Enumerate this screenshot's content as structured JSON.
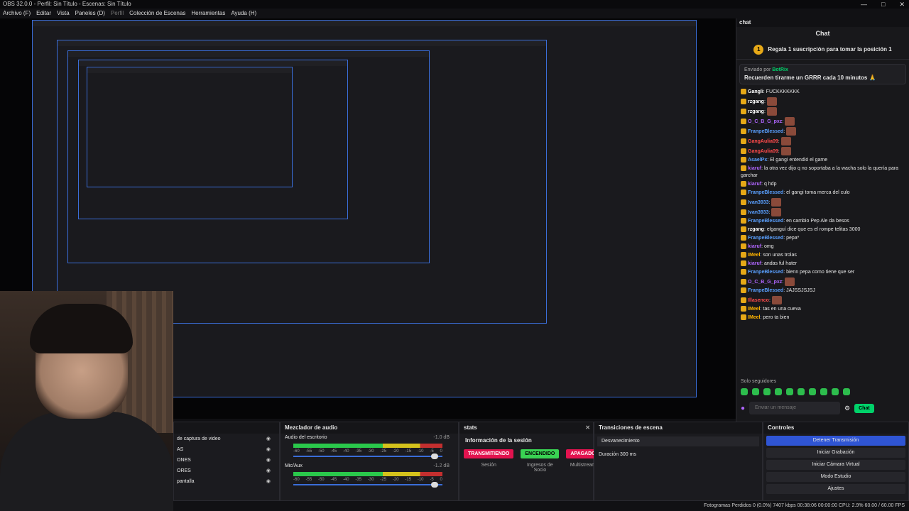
{
  "window": {
    "title": "OBS 32.0.0 - Perfil: Sin Título - Escenas: Sin Título",
    "min": "—",
    "max": "□",
    "close": "✕"
  },
  "menu": [
    "Archivo (F)",
    "Editar",
    "Vista",
    "Paneles (D)",
    "Perfil",
    "Colección de Escenas",
    "Herramientas",
    "Ayuda (H)"
  ],
  "chat": {
    "dock_title": "chat",
    "title": "Chat",
    "promo": "Regala 1 suscripción para tomar la posición 1",
    "promo_badge": "1",
    "pinned_by_prefix": "Enviado por",
    "pinned_user": "BotRix",
    "pinned_msg": "Recuerden tirarme un GRRR cada 10 minutos 🙏",
    "messages": [
      {
        "user": "Gangli",
        "text": "FUCKKKKKKK",
        "color": "#ffffff"
      },
      {
        "user": "rzgang",
        "text": "",
        "emote": true,
        "color": "#ffffff"
      },
      {
        "user": "rzgang",
        "text": "",
        "emote": true,
        "color": "#ffffff"
      },
      {
        "user": "O_C_B_G_pxz",
        "text": "",
        "emote": true,
        "color": "#b066ff"
      },
      {
        "user": "FranpeBlessed",
        "text": "",
        "emote": true,
        "color": "#5aa0ff"
      },
      {
        "user": "GangAulia09",
        "text": "",
        "emote": true,
        "color": "#ff4b4b"
      },
      {
        "user": "GangAulia09",
        "text": "",
        "emote": true,
        "color": "#ff4b4b"
      },
      {
        "user": "AsaelPx",
        "text": "El gangi entendió el game",
        "color": "#5aa0ff"
      },
      {
        "user": "kiaruf",
        "text": "la otra vez dijo q no soportaba a la wacha solo la quería para garchar",
        "color": "#b066ff"
      },
      {
        "user": "kiaruf",
        "text": "q hdp",
        "color": "#b066ff"
      },
      {
        "user": "FranpeBlessed",
        "text": "el gangi toma merca del culo",
        "color": "#5aa0ff"
      },
      {
        "user": "Ivan3933",
        "text": "",
        "emote": true,
        "color": "#5aa0ff"
      },
      {
        "user": "Ivan3933",
        "text": "",
        "emote": true,
        "color": "#5aa0ff"
      },
      {
        "user": "FranpeBlessed",
        "text": "en cambio Pep Ale da besos",
        "color": "#5aa0ff"
      },
      {
        "user": "rzgang",
        "text": "elganguí dice que es el rompe telitas 3000",
        "color": "#ffffff"
      },
      {
        "user": "FranpeBlessed",
        "text": "pepa*",
        "color": "#5aa0ff"
      },
      {
        "user": "kiaruf",
        "text": "omg",
        "color": "#b066ff"
      },
      {
        "user": "IMeel",
        "text": "son unas trolas",
        "color": "#ffb400"
      },
      {
        "user": "kiaruf",
        "text": "andas ful hater",
        "color": "#b066ff"
      },
      {
        "user": "FranpeBlessed",
        "text": "bienn pepa como tiene que ser",
        "color": "#5aa0ff"
      },
      {
        "user": "O_C_B_G_pxz",
        "text": "",
        "emote": true,
        "color": "#b066ff"
      },
      {
        "user": "FranpeBlessed",
        "text": "JAJSSJSJSJ",
        "color": "#5aa0ff"
      },
      {
        "user": "Illasenco",
        "text": "",
        "emote": true,
        "color": "#ff4b4b"
      },
      {
        "user": "IMeel",
        "text": "tas en una cueva",
        "color": "#ffb400"
      },
      {
        "user": "IMeel",
        "text": "pero ta bien",
        "color": "#ffb400"
      }
    ],
    "followers": "Solo seguidores",
    "input_placeholder": "Enviar un mensaje",
    "send": "Chat"
  },
  "sources": {
    "items": [
      "de captura de video",
      "AS",
      "ONES",
      "ORES",
      "pantalla"
    ]
  },
  "mixer": {
    "title": "Mezclador de audio",
    "tracks": [
      {
        "name": "Audio del escritorio",
        "db": "-1.0 dB"
      },
      {
        "name": "Mic/Aux",
        "db": "-1.2 dB"
      }
    ],
    "ticks": [
      "-60",
      "-55",
      "-50",
      "-45",
      "-40",
      "-35",
      "-30",
      "-25",
      "-20",
      "-15",
      "-10",
      "-5",
      "0"
    ],
    "levels": [
      0.97,
      0.97
    ]
  },
  "stats": {
    "title": "stats",
    "session_title": "Información de la sesión",
    "badges": [
      {
        "label": "TRANSMITIENDO",
        "sub": "Sesión",
        "color": "#e3134f"
      },
      {
        "label": "ENCENDIDO",
        "sub": "Ingresos de Socio",
        "color": "#39d353"
      },
      {
        "label": "APAGADO",
        "sub": "Multistream",
        "color": "#e3134f"
      }
    ]
  },
  "transitions": {
    "title": "Transiciones de escena",
    "selected": "Desvanecimiento",
    "duration_label": "Duración",
    "duration": "300 ms"
  },
  "controls": {
    "title": "Controles",
    "buttons": [
      "Detener Transmisión",
      "Iniciar Grabación",
      "Iniciar Cámara Virtual",
      "Modo Estudio",
      "Ajustes"
    ]
  },
  "status": {
    "text": "Fotogramas Perdidos 0 (0.0%)   7407 kbps   00:38:06   00:00:00   CPU: 2.9%   60.00 / 60.00 FPS"
  }
}
